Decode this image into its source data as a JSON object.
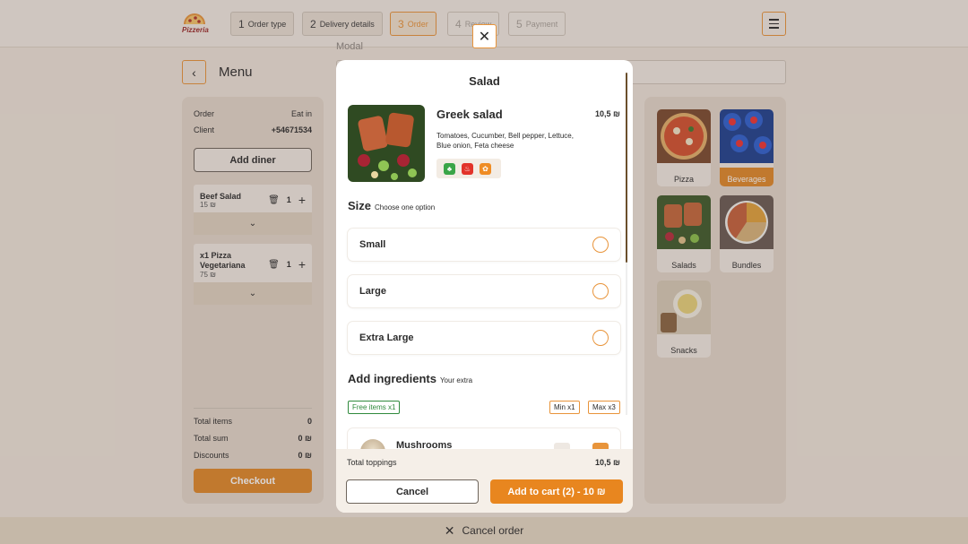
{
  "brand": {
    "name": "Pizzeria"
  },
  "steps": [
    {
      "num": "1",
      "label": "Order type",
      "state": "done"
    },
    {
      "num": "2",
      "label": "Delivery details",
      "state": "done"
    },
    {
      "num": "3",
      "label": "Order",
      "state": "active"
    },
    {
      "num": "4",
      "label": "Review",
      "state": "future"
    },
    {
      "num": "5",
      "label": "Payment",
      "state": "future"
    }
  ],
  "menu": {
    "title": "Menu",
    "modal_label": "Modal"
  },
  "order": {
    "order_label": "Order",
    "order_value": "Eat in",
    "client_label": "Client",
    "client_value": "+54671534",
    "add_diner": "Add diner",
    "items": [
      {
        "name": "Beef Salad",
        "price": "15 ₪",
        "qty": "1"
      },
      {
        "name": "x1 Pizza Vegetariana",
        "price": "75 ₪",
        "qty": "1"
      }
    ],
    "total_items_label": "Total items",
    "total_items": "0",
    "total_sum_label": "Total sum",
    "total_sum": "0 ₪",
    "discounts_label": "Discounts",
    "discounts": "0 ₪",
    "checkout": "Checkout"
  },
  "categories": [
    "Pizza",
    "Beverages",
    "Salads",
    "Bundles",
    "Snacks"
  ],
  "cancel_order": "Cancel order",
  "modal": {
    "title": "Salad",
    "dish_name": "Greek salad",
    "dish_price": "10,5 ₪",
    "dish_desc": "Tomatoes, Cucumber, Bell pepper, Lettuce, Blue onion, Feta cheese",
    "size_title": "Size",
    "size_sub": "Choose one option",
    "sizes": [
      "Small",
      "Large",
      "Extra Large"
    ],
    "ingredients_title": "Add ingredients",
    "ingredients_sub": "Your extra",
    "free_items": "Free items x1",
    "min": "Min x1",
    "max": "Max x3",
    "ingredient": "Mushrooms",
    "total_toppings_label": "Total toppings",
    "total_toppings": "10,5 ₪",
    "cancel": "Cancel",
    "add_to_cart": "Add to cart (2) - 10 ₪"
  }
}
